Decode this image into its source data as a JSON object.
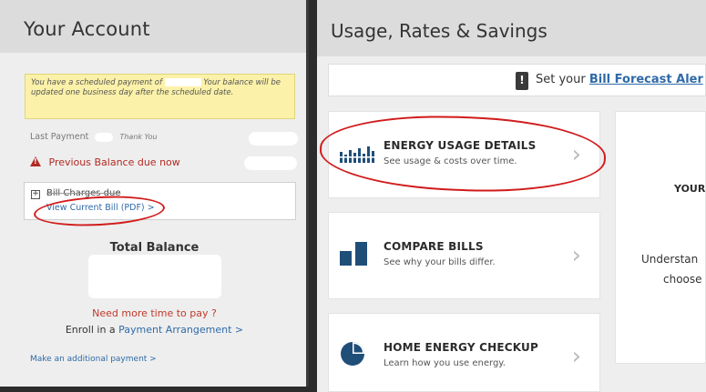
{
  "left": {
    "title": "Your Account",
    "notice": {
      "part1": "You have a scheduled payment of",
      "part2": "Your balance will be updated one business day after the scheduled date."
    },
    "last_payment": {
      "label": "Last Payment",
      "thanks": "Thank You"
    },
    "previous_balance": "Previous Balance due now",
    "bill_charges": {
      "toggle": "+",
      "label": "Bill Charges due",
      "view_link": "View Current Bill (PDF) >"
    },
    "total_balance": "Total Balance",
    "need_time": "Need more time to pay ?",
    "enroll_prefix": "Enroll in a",
    "enroll_link": "Payment Arrangement >",
    "additional_payment": "Make an additional payment >"
  },
  "right": {
    "title": "Usage, Rates & Savings",
    "forecast": {
      "icon": "!",
      "prefix": "Set your",
      "link": "Bill Forecast Aler"
    },
    "cards": [
      {
        "icon": "bar-chart-icon",
        "title": "ENERGY USAGE DETAILS",
        "subtitle": "See usage & costs over time."
      },
      {
        "icon": "compare-bars-icon",
        "title": "COMPARE BILLS",
        "subtitle": "See why your bills differ."
      },
      {
        "icon": "pie-chart-icon",
        "title": "HOME ENERGY CHECKUP",
        "subtitle": "Learn how you use energy."
      }
    ],
    "side_card": {
      "heading": "YOUR",
      "line1": "Understan",
      "line2": "choose"
    }
  },
  "colors": {
    "link": "#2f6aa8",
    "warning": "#b32a22",
    "annotation": "#d11b1b",
    "notice_bg": "#fbf1a8"
  }
}
